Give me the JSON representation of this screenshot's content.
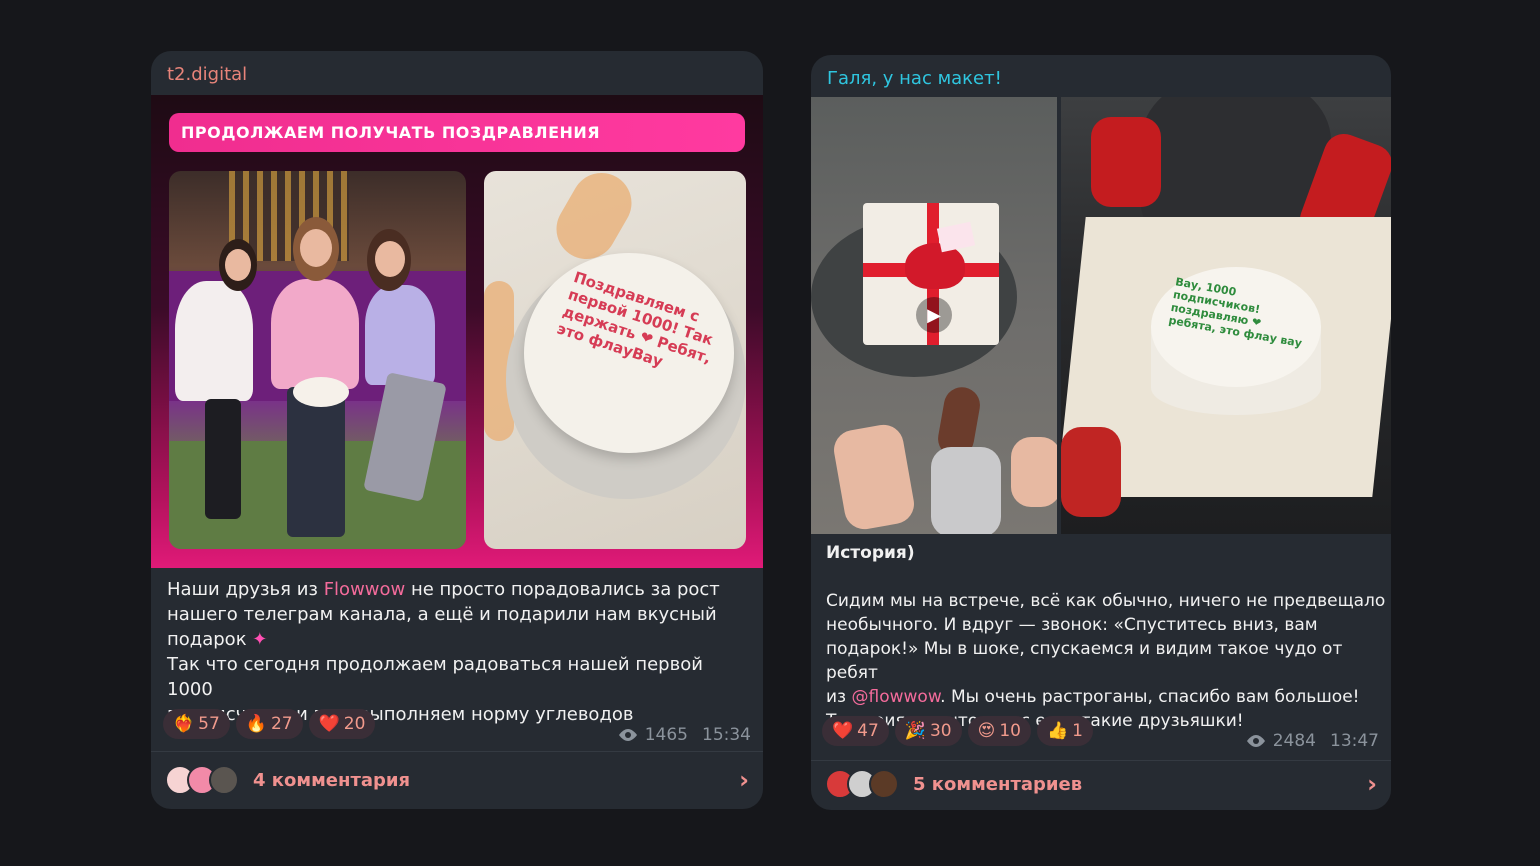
{
  "posts": [
    {
      "channel": "t2.digital",
      "banner": "ПРОДОЛЖАЕМ ПОЛУЧАТЬ ПОЗДРАВЛЕНИЯ",
      "cake_text": "Поздравляем с первой 1000! Так держать ❤ Ребят, это флауВау",
      "text_part1": "Наши друзья из ",
      "text_link": "Flowwow",
      "text_part2": " не просто порадовались за рост\nнашего телеграм канала, а ещё и подарили нам вкусный\nподарок ",
      "text_part3": "\nТак что сегодня продолжаем радоваться нашей первой 1000\nподписчиков и перевыполняем норму углеводов",
      "sparkle": "✦",
      "reactions": [
        {
          "emoji": "❤️‍🔥",
          "count": "57"
        },
        {
          "emoji": "🔥",
          "count": "27"
        },
        {
          "emoji": "❤️",
          "count": "20"
        }
      ],
      "views": "1465",
      "time": "15:34",
      "comments_label": "4 комментария",
      "chevron": "›"
    },
    {
      "channel": "Галя, у нас макет!",
      "cake_text": "Вау, 1000 подписчиков! поздравляю ❤ ребята, это флау вау",
      "play": "▶",
      "title": "История)",
      "text_part1": "Сидим мы на встрече, всё как обычно, ничего не предвещало\nнеобычного. И вдруг — звонок: «Спуститесь вниз, вам\nподарок!» Мы в шоке, спускаемся и видим такое чудо от ребят\nиз ",
      "text_link": "@flowwow",
      "text_part2": ". Мы очень растроганы, спасибо вам большое!\nТак приятно, что у нас есть такие друзьяшки!",
      "reactions": [
        {
          "emoji": "❤️",
          "count": "47"
        },
        {
          "emoji": "🎉",
          "count": "30"
        },
        {
          "emoji": "😍",
          "count": "10"
        },
        {
          "emoji": "👍",
          "count": "1"
        }
      ],
      "views": "2484",
      "time": "13:47",
      "comments_label": "5 комментариев",
      "chevron": "›"
    }
  ],
  "colors": {
    "background": "#16171b",
    "card": "#262b32",
    "channel1": "#e8847a",
    "channel2": "#2fc6e0",
    "accent": "#f0918f",
    "link": "#f36b9b"
  }
}
